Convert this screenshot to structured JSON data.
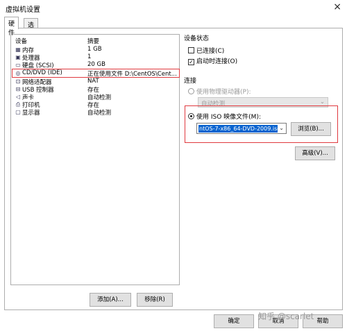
{
  "window": {
    "title": "虚拟机设置",
    "close_glyph": "×"
  },
  "tabs": [
    {
      "label": "硬件"
    },
    {
      "label": "选项"
    }
  ],
  "device_list": {
    "col_device": "设备",
    "col_summary": "摘要",
    "rows": [
      {
        "icon": "memory-icon",
        "glyph": "▦",
        "name": "内存",
        "summary": "1 GB"
      },
      {
        "icon": "cpu-icon",
        "glyph": "▣",
        "name": "处理器",
        "summary": "1"
      },
      {
        "icon": "harddisk-icon",
        "glyph": "▭",
        "name": "硬盘 (SCSI)",
        "summary": "20 GB"
      },
      {
        "icon": "cd-icon",
        "glyph": "◎",
        "name": "CD/DVD (IDE)",
        "summary": "正在使用文件 D:\\CentOS\\Cent..."
      },
      {
        "icon": "network-icon",
        "glyph": "⊡",
        "name": "网络适配器",
        "summary": "NAT"
      },
      {
        "icon": "usb-icon",
        "glyph": "⊟",
        "name": "USB 控制器",
        "summary": "存在"
      },
      {
        "icon": "sound-icon",
        "glyph": "◁",
        "name": "声卡",
        "summary": "自动检测"
      },
      {
        "icon": "printer-icon",
        "glyph": "⎙",
        "name": "打印机",
        "summary": "存在"
      },
      {
        "icon": "display-icon",
        "glyph": "▢",
        "name": "显示器",
        "summary": "自动检测"
      }
    ]
  },
  "buttons": {
    "add": "添加(A)...",
    "remove": "移除(R)",
    "browse": "浏览(B)...",
    "advanced": "高级(V)...",
    "ok": "确定",
    "cancel": "取消",
    "help": "帮助"
  },
  "device_status": {
    "title": "设备状态",
    "connected": {
      "label": "已连接(C)",
      "checked": false
    },
    "connect_at_power_on": {
      "label": "启动时连接(O)",
      "checked": true,
      "mark": "✓"
    }
  },
  "connection": {
    "title": "连接",
    "physical_drive": {
      "label": "使用物理驱动器(P):",
      "selected": false
    },
    "physical_drive_value": "自动检测",
    "iso_image": {
      "label": "使用 ISO 映像文件(M):",
      "selected": true
    },
    "iso_path": "ntOS-7-x86_64-DVD-2009.iso"
  },
  "watermark": "知乎 @scarlet",
  "colors": {
    "highlight": "#e0393e",
    "selection": "#0a64d0"
  }
}
